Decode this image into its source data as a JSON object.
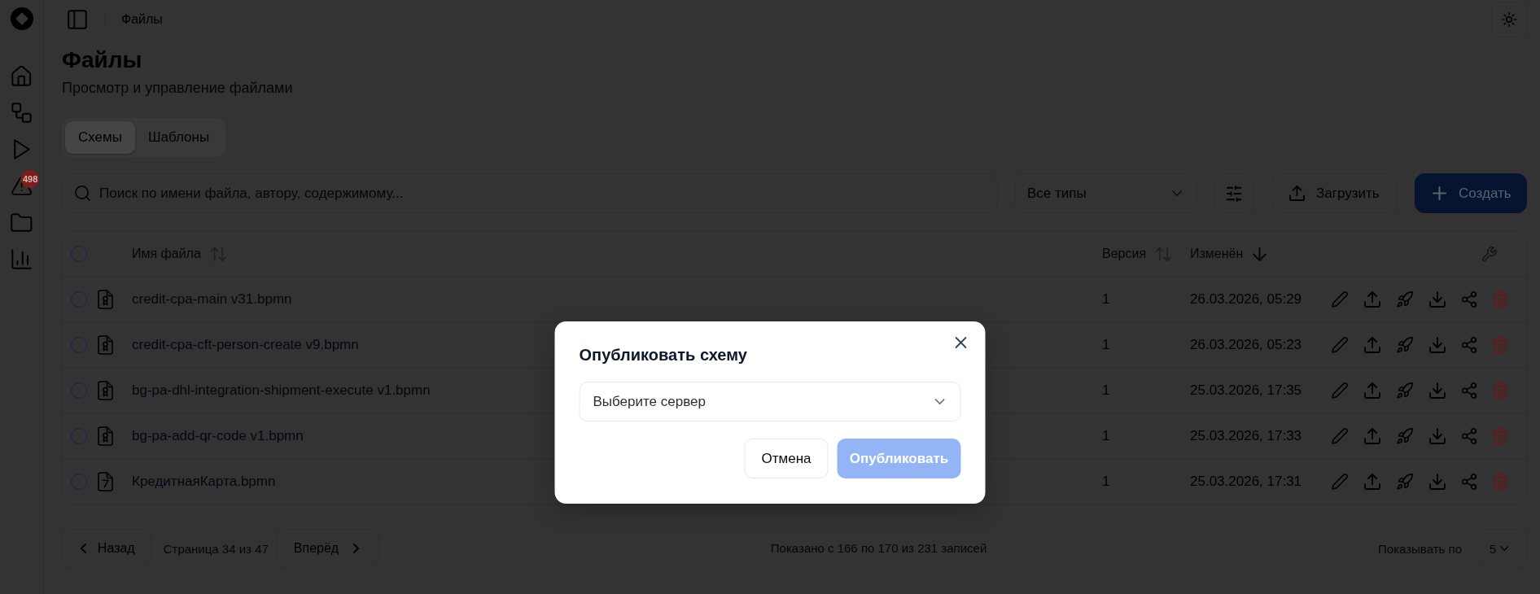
{
  "sidebar": {
    "alerts_badge": "498"
  },
  "header": {
    "breadcrumb": "Файлы"
  },
  "page": {
    "title": "Файлы",
    "subtitle": "Просмотр и управление файлами"
  },
  "tabs": [
    {
      "label": "Схемы",
      "selected": true
    },
    {
      "label": "Шаблоны",
      "selected": false
    }
  ],
  "toolbar": {
    "search": {
      "placeholder": "Поиск по имени файла, автору, содержимому..."
    },
    "type_filter": {
      "value": "Все типы"
    },
    "upload_button": "Загрузить",
    "create_button": "Создать"
  },
  "table": {
    "select_all_checked": false,
    "columns": [
      {
        "label": "Имя файла",
        "sorted": false
      },
      {
        "label": "Версия",
        "sorted": false
      },
      {
        "label": "Изменён",
        "sorted": true,
        "descending": true
      }
    ],
    "rows": [
      {
        "checked": false,
        "kind": "badge",
        "name": "credit-cpa-main v31.bpmn",
        "version": "1",
        "modified": "26.03.2026, 05:29"
      },
      {
        "checked": false,
        "kind": "badge",
        "name": "credit-cpa-cft-person-create v9.bpmn",
        "version": "1",
        "modified": "26.03.2026, 05:23"
      },
      {
        "checked": false,
        "kind": "badge",
        "name": "bg-pa-dhl-integration-shipment-execute v1.bpmn",
        "version": "1",
        "modified": "25.03.2026, 17:35"
      },
      {
        "checked": false,
        "kind": "badge",
        "name": "bg-pa-add-qr-code v1.bpmn",
        "version": "1",
        "modified": "25.03.2026, 17:33"
      },
      {
        "checked": false,
        "kind": "pen",
        "name": "КредитнаяКарта.bpmn",
        "version": "1",
        "modified": "25.03.2026, 17:31"
      }
    ]
  },
  "pagination": {
    "prev_button": "Назад",
    "page_info": "Страница 34 из 47",
    "next_button": "Вперёд",
    "summary": "Показано с 166 по 170 из 231 записей",
    "page_size_label": "Показывать по",
    "page_size": "5"
  },
  "modal": {
    "title": "Опубликовать схему",
    "server_select": {
      "placeholder": "Выберите сервер"
    },
    "cancel_button": "Отмена",
    "publish_button": {
      "label": "Опубликовать",
      "disabled": true
    }
  }
}
